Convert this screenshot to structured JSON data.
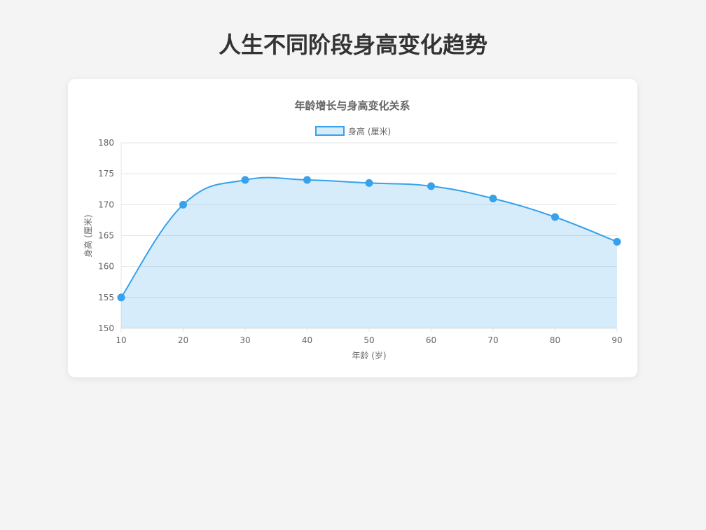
{
  "page": {
    "title": "人生不同阶段身高变化趋势"
  },
  "colors": {
    "line": "#36a2eb",
    "fill": "rgba(54, 162, 235, 0.2)",
    "grid": "#e5e5e5",
    "text": "#666666"
  },
  "chart_data": {
    "type": "line",
    "title": "年龄增长与身高变化关系",
    "xlabel": "年龄 (岁)",
    "ylabel": "身高 (厘米)",
    "x": [
      10,
      20,
      30,
      40,
      50,
      60,
      70,
      80,
      90
    ],
    "series": [
      {
        "name": "身高 (厘米)",
        "values": [
          155,
          170,
          174,
          174,
          173.5,
          173,
          171,
          168,
          164
        ]
      }
    ],
    "ylim": [
      150,
      180
    ],
    "yticks": [
      150,
      155,
      160,
      165,
      170,
      175,
      180
    ],
    "xticks": [
      10,
      20,
      30,
      40,
      50,
      60,
      70,
      80,
      90
    ],
    "grid": true,
    "filled": true,
    "smooth": true,
    "legend_position": "top"
  }
}
